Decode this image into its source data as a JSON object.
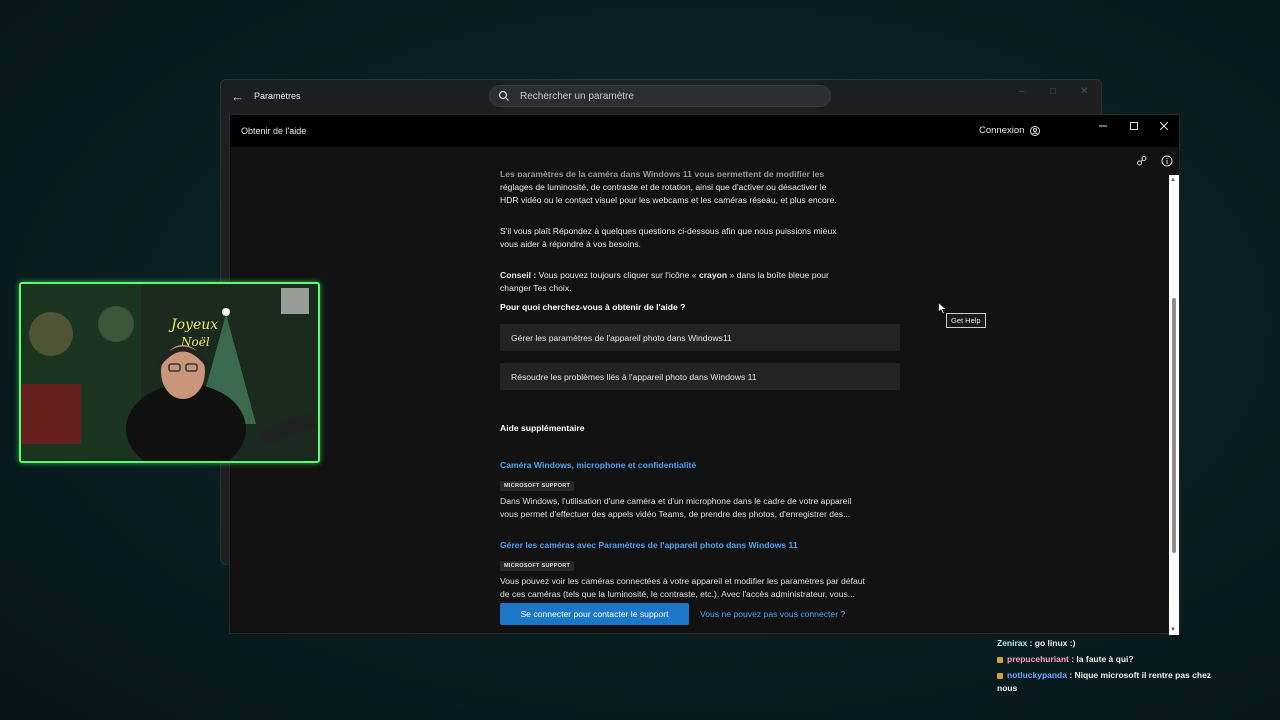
{
  "settings_window": {
    "title": "Paramètres",
    "search_placeholder": "Rechercher un paramètre"
  },
  "help_window": {
    "title": "Obtenir de l'aide",
    "sign_in_label": "Connexion",
    "intro_faded": "Les paramètres de la caméra dans Windows 11 vous permettent de modifier les",
    "intro_line1": "réglages de luminosité, de contraste et de rotation, ainsi que d'activer ou désactiver le",
    "intro_line2": "HDR vidéo ou le contact visuel pour les webcams et les caméras réseau, et plus encore.",
    "prompt_line1": "S'il vous plaît Répondez à quelques questions ci-dessous afin que nous puissions mieux",
    "prompt_line2": "vous aider à répondre à vos besoins.",
    "tip_label": "Conseil :",
    "tip_text_a": " Vous pouvez toujours cliquer sur l'icône « ",
    "tip_bold": "crayon",
    "tip_text_b": " » dans la boîte bleue pour",
    "tip_line2": "changer Tes choix.",
    "question": "Pour quoi cherchez-vous à obtenir de l'aide ?",
    "option1": "Gérer les paramètres de l'appareil photo dans Windows11",
    "option2": "Résoudre les problèmes liés à l'appareil photo dans Windows 11",
    "more_help_heading": "Aide supplémentaire",
    "article1": {
      "title": "Caméra Windows, microphone et confidentialité",
      "badge": "MICROSOFT SUPPORT",
      "desc_line1": "Dans Windows, l'utilisation d'une caméra et d'un microphone dans le cadre de votre appareil",
      "desc_line2": "vous permet d'effectuer des appels vidéo Teams, de prendre des photos, d'enregistrer des..."
    },
    "article2": {
      "title": "Gérer les caméras avec Paramètres de l'appareil photo dans Windows 11",
      "badge": "MICROSOFT SUPPORT",
      "desc_line1": "Vous pouvez voir les caméras connectées à votre appareil et modifier les paramètres par défaut",
      "desc_line2": "de ces caméras (tels que la luminosité, le contraste, etc.). Avec l'accès administrateur, vous..."
    },
    "contact_button": "Se connecter pour contacter le support",
    "cant_sign_in_link": "Vous ne pouvez pas vous connecter ?",
    "tooltip": "Get Help"
  },
  "chat": [
    {
      "user": "Zenirax",
      "message": " : go linux :)"
    },
    {
      "user": "prepucehuriant",
      "message": " : la faute à qui?"
    },
    {
      "user": "notluckypanda",
      "message": " : Nique microsoft il rentre pas chez nous"
    }
  ],
  "colors": {
    "accent": "#1d77c9",
    "link": "#4ea3f0",
    "webcam_border": "#55ff6e"
  }
}
